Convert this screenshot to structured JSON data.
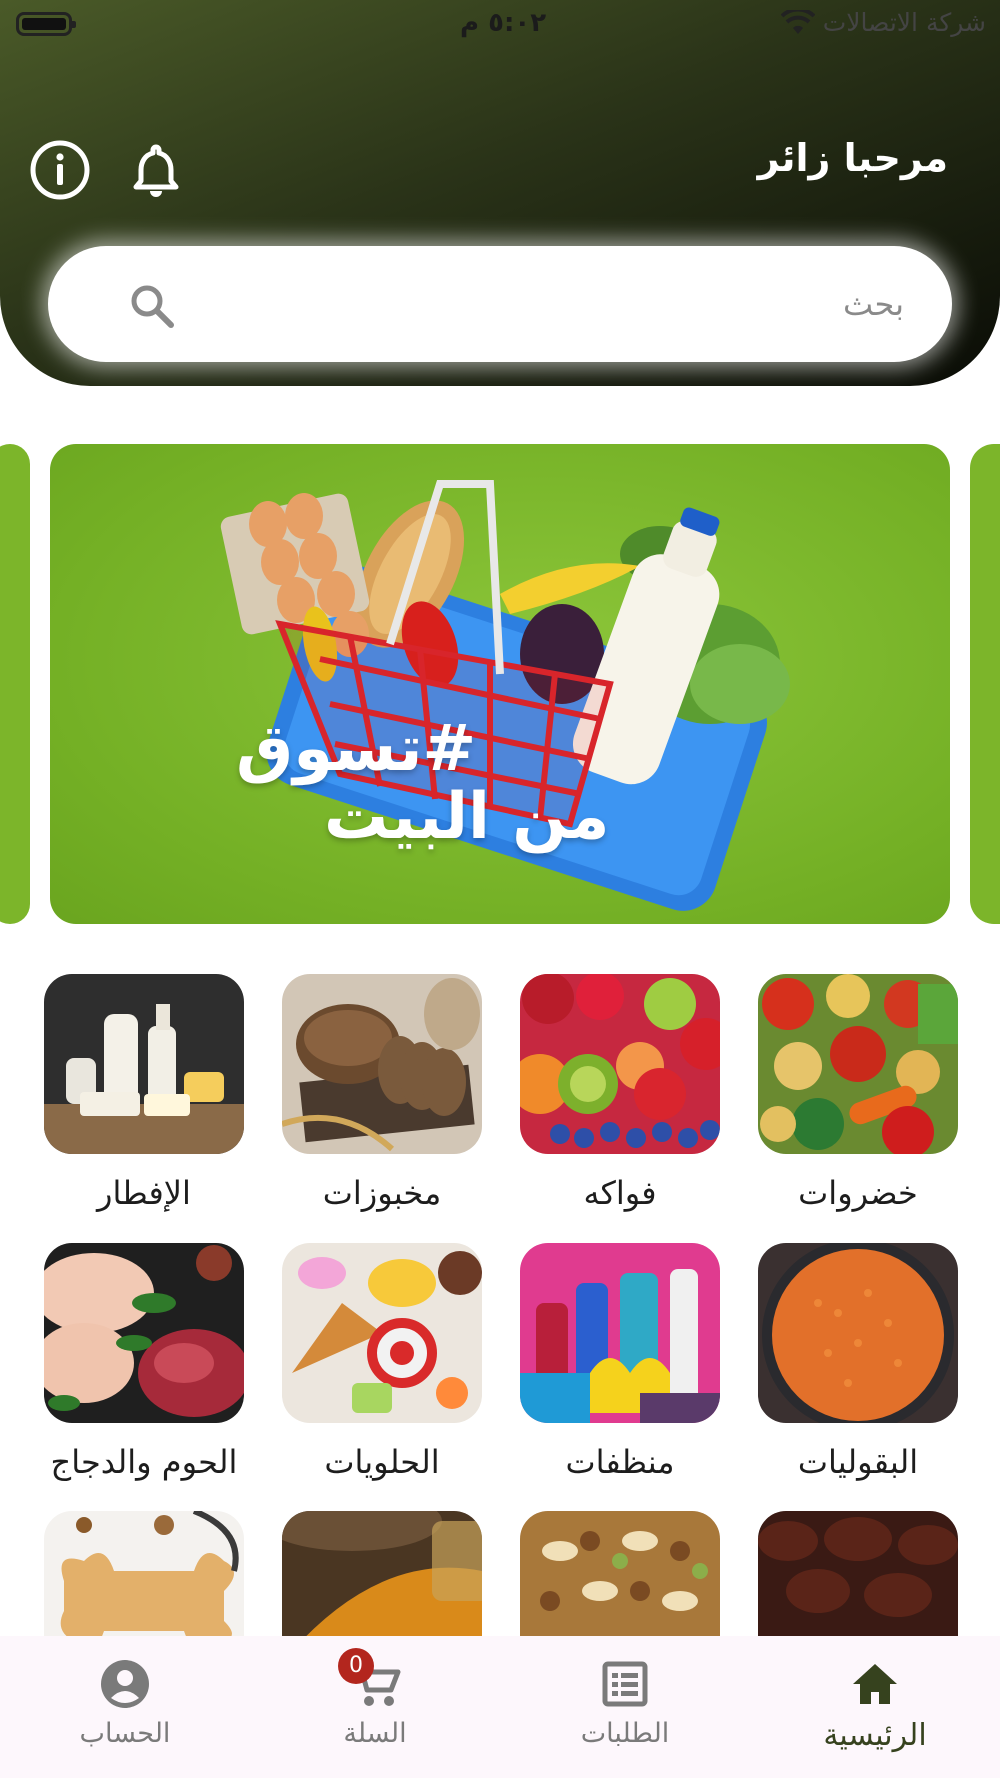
{
  "status_bar": {
    "time": "٥:٠٢ م",
    "carrier": "شركة الاتصالات"
  },
  "header": {
    "greeting": "مرحبا زائر"
  },
  "search": {
    "placeholder": "بحث"
  },
  "banner": {
    "line1": "#تسوق",
    "line2": "من البيت"
  },
  "categories": [
    {
      "label": "خضروات",
      "icon": "vegetables"
    },
    {
      "label": "فواكه",
      "icon": "fruits"
    },
    {
      "label": "مخبوزات",
      "icon": "bread"
    },
    {
      "label": "الإفطار",
      "icon": "dairy"
    },
    {
      "label": "البقوليات",
      "icon": "lentils"
    },
    {
      "label": "منظفات",
      "icon": "cleaning"
    },
    {
      "label": "الحلويات",
      "icon": "sweets"
    },
    {
      "label": "الحوم والدجاج",
      "icon": "meat"
    },
    {
      "label": "",
      "icon": "dates"
    },
    {
      "label": "",
      "icon": "nuts"
    },
    {
      "label": "",
      "icon": "spices"
    },
    {
      "label": "",
      "icon": "pet-food"
    }
  ],
  "bottom_nav": {
    "items": [
      {
        "label": "الرئيسية",
        "icon": "home-icon",
        "active": true
      },
      {
        "label": "الطلبات",
        "icon": "orders-icon",
        "active": false
      },
      {
        "label": "السلة",
        "icon": "cart-icon",
        "active": false,
        "badge": "0"
      },
      {
        "label": "الحساب",
        "icon": "account-icon",
        "active": false
      }
    ]
  },
  "colors": {
    "brand_dark": "#36421e",
    "banner_green": "#7cb52a",
    "badge_red": "#b3261e"
  }
}
